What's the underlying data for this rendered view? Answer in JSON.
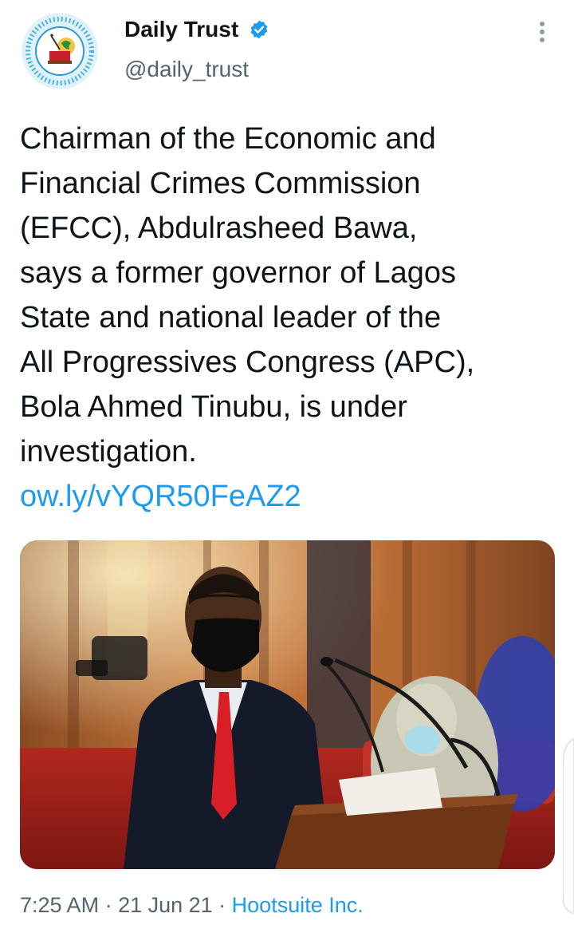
{
  "account": {
    "display_name": "Daily Trust",
    "handle": "@daily_trust",
    "verified_icon": "verified-badge-icon",
    "more_icon": "more-vertical-icon"
  },
  "tweet": {
    "lines": [
      "Chairman of the Economic and",
      "Financial Crimes Commission",
      "(EFCC), Abdulrasheed Bawa,",
      "says a former governor of Lagos",
      "State and national leader of the",
      "All Progressives Congress (APC),",
      "Bola Ahmed Tinubu, is under",
      "investigation."
    ],
    "link": "ow.ly/vYQR50FeAZ2"
  },
  "meta": {
    "time": "7:25 AM",
    "sep1": " · ",
    "date": "21 Jun 21",
    "sep2": " · ",
    "source": "Hootsuite Inc."
  },
  "colors": {
    "link": "#1d9bf0",
    "secondary_text": "#536471",
    "primary_text": "#0f1419",
    "verified": "#1d9bf0"
  }
}
